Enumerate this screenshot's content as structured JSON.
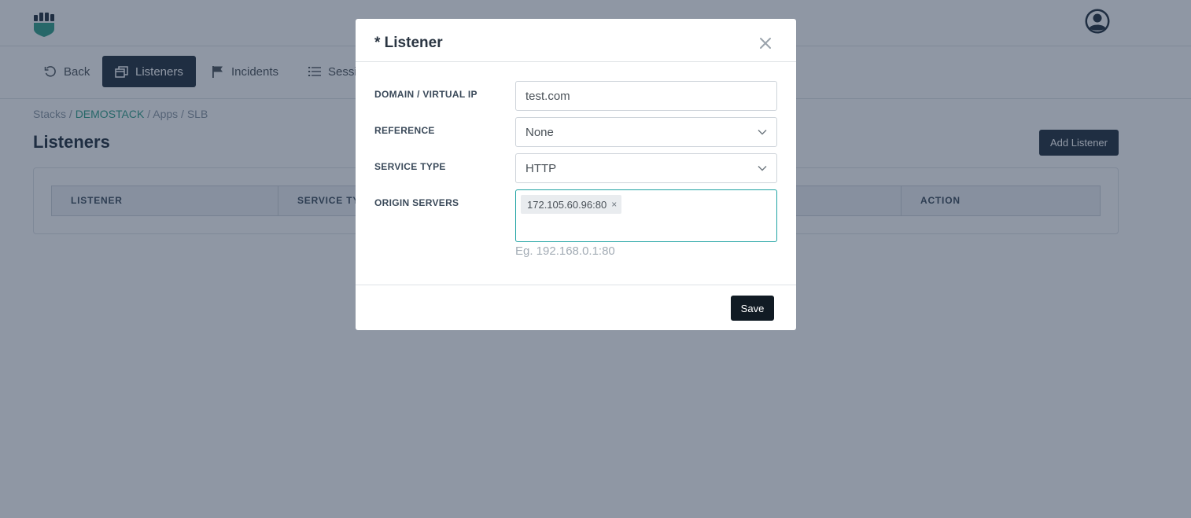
{
  "brand": {
    "logo_icon": "fist-shield-logo",
    "accent": "#2e9f88"
  },
  "user": {
    "avatar_icon": "user-avatar-icon"
  },
  "nav": {
    "back_label": "Back",
    "tabs": [
      {
        "label": "Listeners",
        "icon": "window-icon",
        "active": true
      },
      {
        "label": "Incidents",
        "icon": "flag-icon",
        "active": false
      },
      {
        "label": "Sessi",
        "icon": "list-icon",
        "active": false
      }
    ]
  },
  "breadcrumb": {
    "items": [
      "Stacks",
      "DEMOSTACK",
      "Apps",
      "SLB"
    ],
    "separator": "/"
  },
  "page": {
    "title": "Listeners",
    "add_button_label": "Add Listener"
  },
  "table": {
    "headers": [
      "LISTENER",
      "SERVICE TY",
      "ACTION"
    ]
  },
  "modal": {
    "title": "* Listener",
    "close_icon": "close-icon",
    "fields": {
      "domain": {
        "label": "DOMAIN / VIRTUAL IP",
        "value": "test.com"
      },
      "reference": {
        "label": "REFERENCE",
        "value": "None"
      },
      "service_type": {
        "label": "SERVICE TYPE",
        "value": "HTTP"
      },
      "origin_servers": {
        "label": "ORIGIN SERVERS",
        "tags": [
          "172.105.60.96:80"
        ],
        "remove_symbol": "×",
        "help": "Eg. 192.168.0.1:80"
      }
    },
    "save_label": "Save"
  }
}
